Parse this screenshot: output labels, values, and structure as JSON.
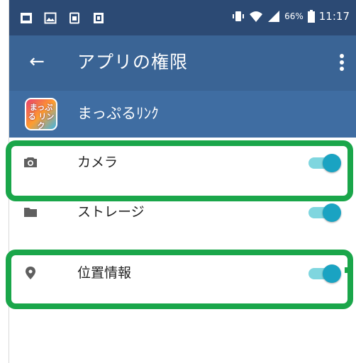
{
  "statusbar": {
    "left_icons": [
      "gallery-icon",
      "image-icon",
      "sim-icon",
      "document-icon"
    ],
    "right_icons": [
      "vibrate-icon",
      "wifi-icon",
      "signal-icon",
      "battery-icon"
    ],
    "battery_percent": "66%",
    "time": "11:17"
  },
  "appbar": {
    "back_icon": "←",
    "title": "アプリの権限",
    "menu_icon": "more-vert-icon"
  },
  "app": {
    "logo_text": "まっぷる リンク",
    "name": "まっぷるﾘﾝｸ"
  },
  "permissions": [
    {
      "label": "カメラ",
      "icon": "camera-icon",
      "enabled": true,
      "highlighted": true
    },
    {
      "label": "ストレージ",
      "icon": "folder-icon",
      "enabled": true,
      "highlighted": false
    },
    {
      "label": "位置情報",
      "icon": "location-icon",
      "enabled": true,
      "highlighted": true
    }
  ],
  "colors": {
    "statusbar": "#2c4a74",
    "appbar": "#3a6495",
    "app_header": "#3f6da2",
    "toggle_on": "#1aa3c2",
    "highlight": "#1aa64a"
  }
}
